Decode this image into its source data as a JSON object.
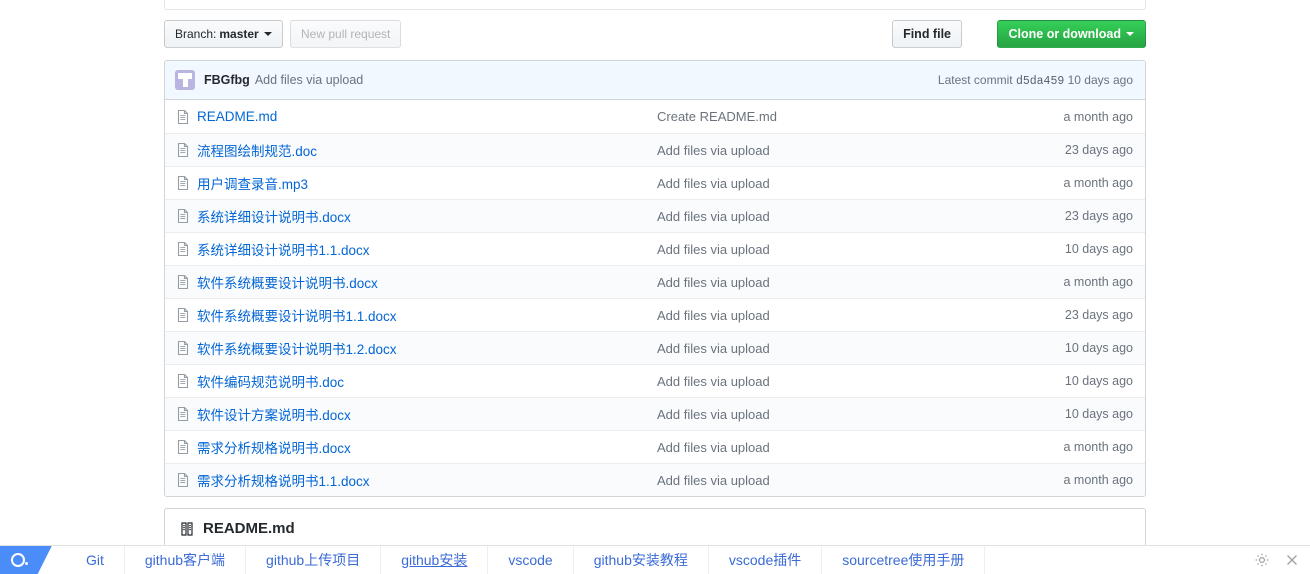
{
  "toolbar": {
    "branch_prefix": "Branch:",
    "branch_name": "master",
    "new_pull_request": "New pull request",
    "find_file": "Find file",
    "clone_or_download": "Clone or download"
  },
  "commit_header": {
    "author": "FBGfbg",
    "message": "Add files via upload",
    "latest_commit_label": "Latest commit",
    "sha": "d5da459",
    "age": "10 days ago"
  },
  "files": [
    {
      "name": "README.md",
      "message": "Create README.md",
      "age": "a month ago"
    },
    {
      "name": "流程图绘制规范.doc",
      "message": "Add files via upload",
      "age": "23 days ago"
    },
    {
      "name": "用户调查录音.mp3",
      "message": "Add files via upload",
      "age": "a month ago"
    },
    {
      "name": "系统详细设计说明书.docx",
      "message": "Add files via upload",
      "age": "23 days ago"
    },
    {
      "name": "系统详细设计说明书1.1.docx",
      "message": "Add files via upload",
      "age": "10 days ago"
    },
    {
      "name": "软件系统概要设计说明书.docx",
      "message": "Add files via upload",
      "age": "a month ago"
    },
    {
      "name": "软件系统概要设计说明书1.1.docx",
      "message": "Add files via upload",
      "age": "23 days ago"
    },
    {
      "name": "软件系统概要设计说明书1.2.docx",
      "message": "Add files via upload",
      "age": "10 days ago"
    },
    {
      "name": "软件编码规范说明书.doc",
      "message": "Add files via upload",
      "age": "10 days ago"
    },
    {
      "name": "软件设计方案说明书.docx",
      "message": "Add files via upload",
      "age": "10 days ago"
    },
    {
      "name": "需求分析规格说明书.docx",
      "message": "Add files via upload",
      "age": "a month ago"
    },
    {
      "name": "需求分析规格说明书1.1.docx",
      "message": "Add files via upload",
      "age": "a month ago"
    }
  ],
  "readme": {
    "title": "README.md"
  },
  "taskbar": {
    "items": [
      {
        "label": "Git",
        "underlined": false
      },
      {
        "label": "github客户端",
        "underlined": false
      },
      {
        "label": "github上传项目",
        "underlined": false
      },
      {
        "label": "github安装",
        "underlined": true
      },
      {
        "label": "vscode",
        "underlined": false
      },
      {
        "label": "github安装教程",
        "underlined": false
      },
      {
        "label": "vscode插件",
        "underlined": false
      },
      {
        "label": "sourcetree使用手册",
        "underlined": false
      }
    ]
  },
  "colors": {
    "link": "#0366d6",
    "green_button": "#28a745",
    "commit_header_bg": "#f1f8ff",
    "border": "#d1d5da",
    "muted_text": "#6a737d",
    "taskbar_link": "#3b6bd6",
    "taskbar_logo": "#4b8df8"
  }
}
